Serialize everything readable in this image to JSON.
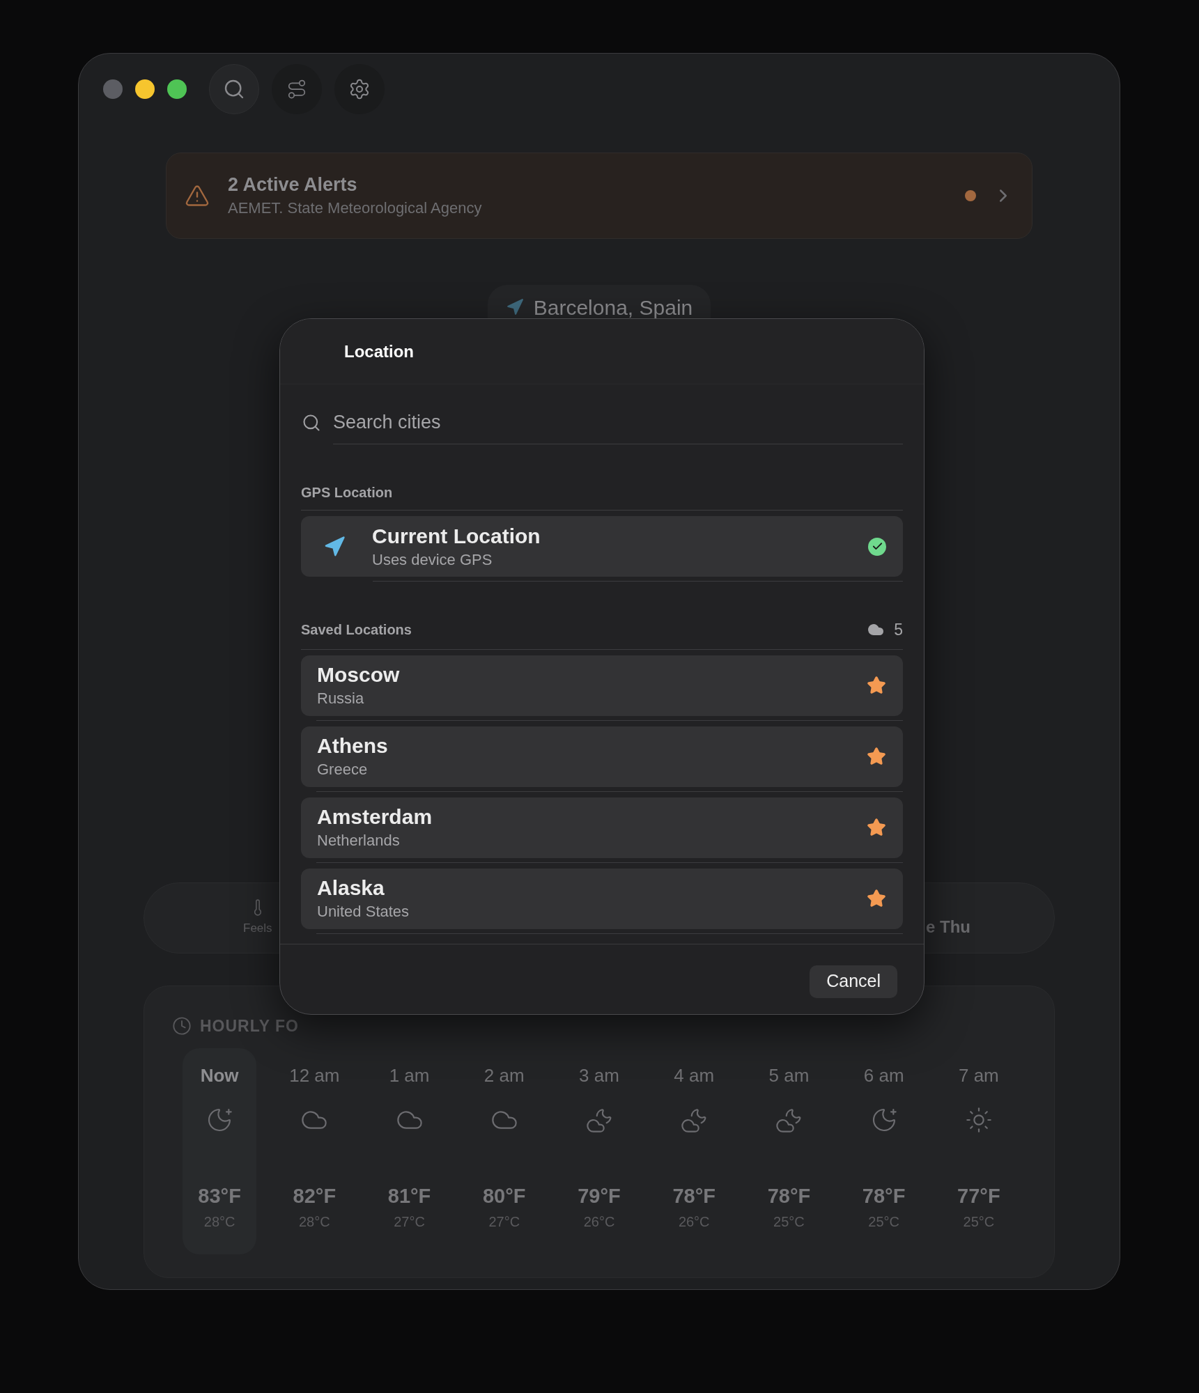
{
  "window": {
    "traffic_lights": [
      {
        "color": "#5c5d63"
      },
      {
        "color": "#f6c52e"
      },
      {
        "color": "#4fc455"
      }
    ]
  },
  "alert": {
    "title": "2 Active Alerts",
    "source": "AEMET. State Meteorological Agency"
  },
  "location_pill": {
    "label": "Barcelona, Spain"
  },
  "conditions_bar": {
    "left_label": "Feels",
    "right_label": "e Thu"
  },
  "hourly": {
    "title": "HOURLY FO",
    "items": [
      {
        "time": "Now",
        "kind": "moon",
        "temp_f": "83°F",
        "temp_c": "28°C",
        "selected": true
      },
      {
        "time": "12 am",
        "kind": "cloud",
        "temp_f": "82°F",
        "temp_c": "28°C",
        "selected": false
      },
      {
        "time": "1 am",
        "kind": "cloud",
        "temp_f": "81°F",
        "temp_c": "27°C",
        "selected": false
      },
      {
        "time": "2 am",
        "kind": "cloud",
        "temp_f": "80°F",
        "temp_c": "27°C",
        "selected": false
      },
      {
        "time": "3 am",
        "kind": "cloudmoon",
        "temp_f": "79°F",
        "temp_c": "26°C",
        "selected": false
      },
      {
        "time": "4 am",
        "kind": "cloudmoon",
        "temp_f": "78°F",
        "temp_c": "26°C",
        "selected": false
      },
      {
        "time": "5 am",
        "kind": "cloudmoon",
        "temp_f": "78°F",
        "temp_c": "25°C",
        "selected": false
      },
      {
        "time": "6 am",
        "kind": "moon",
        "temp_f": "78°F",
        "temp_c": "25°C",
        "selected": false
      },
      {
        "time": "7 am",
        "kind": "sun",
        "temp_f": "77°F",
        "temp_c": "25°C",
        "selected": false
      }
    ]
  },
  "dialog": {
    "title": "Location",
    "search": {
      "placeholder": "Search cities"
    },
    "gps": {
      "heading": "GPS Location",
      "title": "Current Location",
      "subtitle": "Uses device GPS",
      "checked": true
    },
    "saved": {
      "heading": "Saved Locations",
      "count": "5",
      "items": [
        {
          "name": "Moscow",
          "country": "Russia",
          "favorite": true
        },
        {
          "name": "Athens",
          "country": "Greece",
          "favorite": true
        },
        {
          "name": "Amsterdam",
          "country": "Netherlands",
          "favorite": true
        },
        {
          "name": "Alaska",
          "country": "United States",
          "favorite": true
        }
      ]
    },
    "cancel": "Cancel"
  }
}
